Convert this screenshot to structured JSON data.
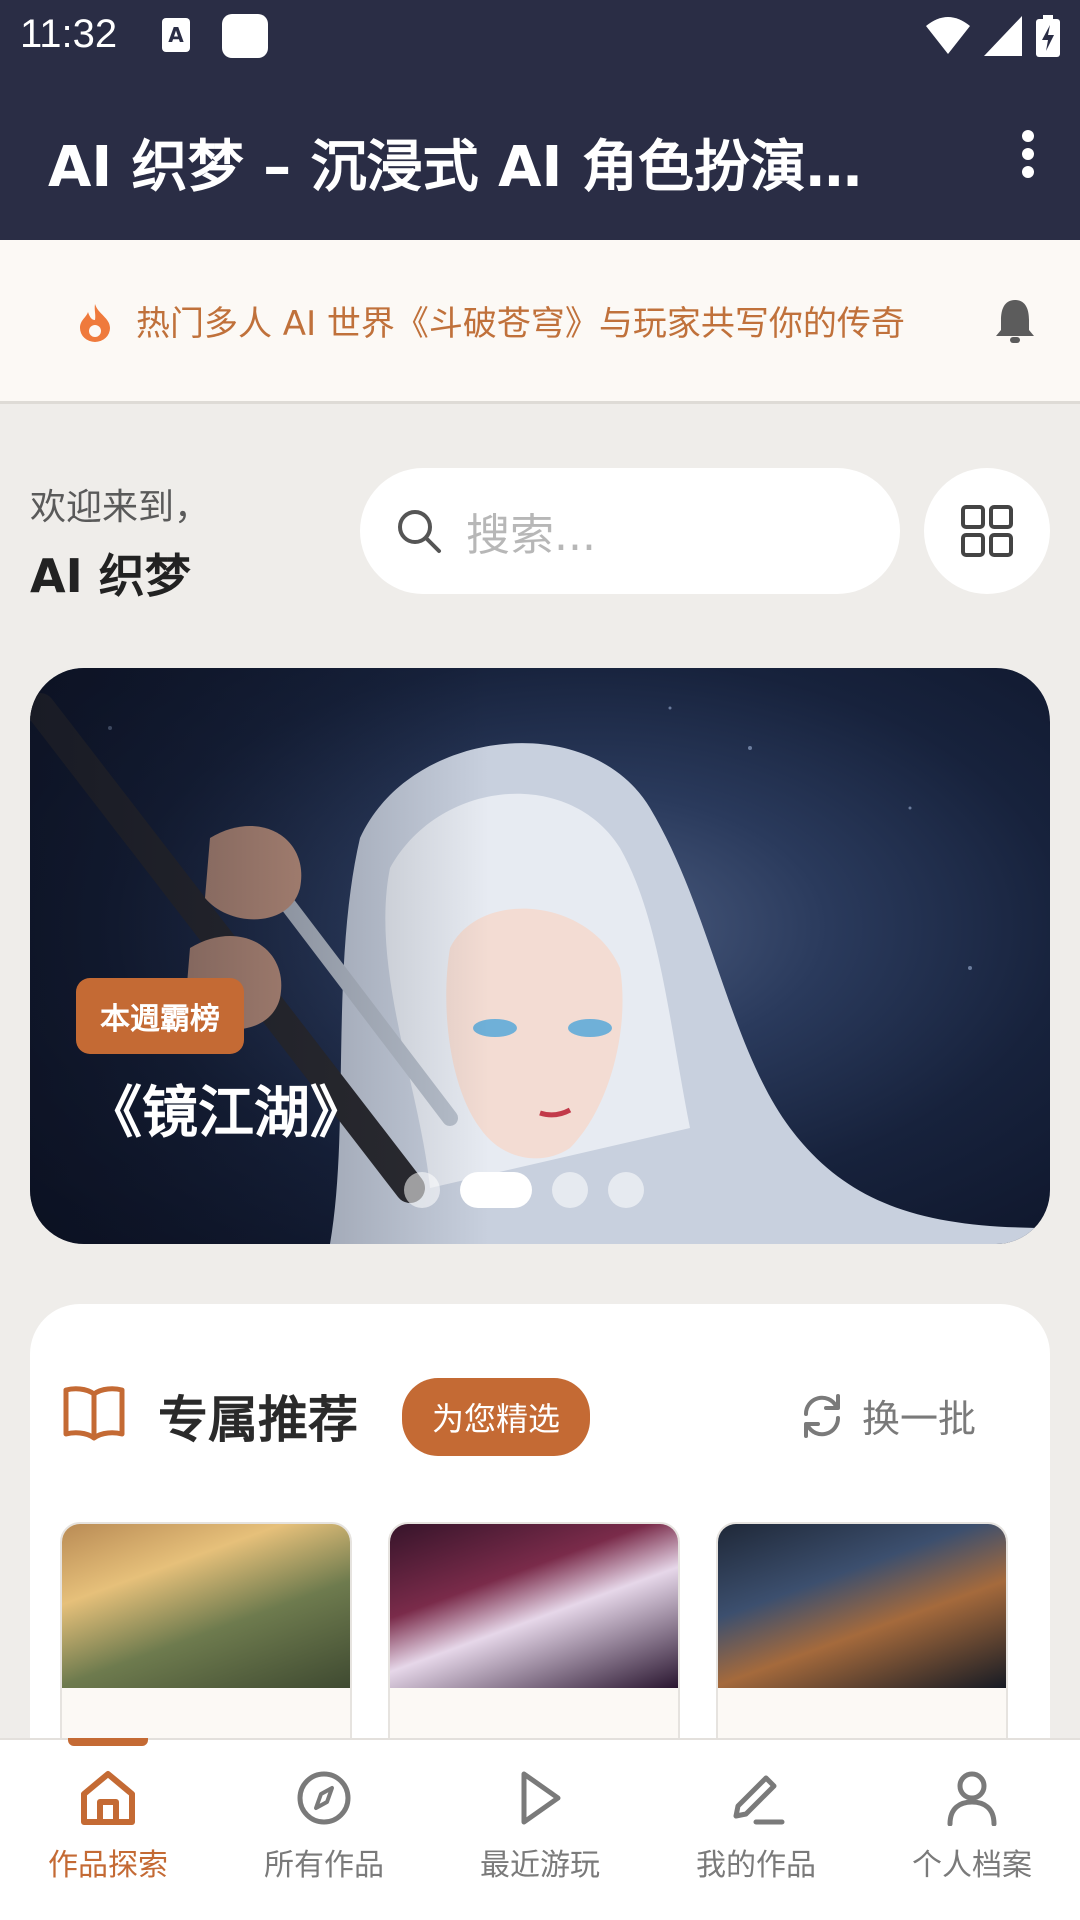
{
  "status_bar": {
    "time": "11:32",
    "keyboard_label": "A"
  },
  "app_bar": {
    "title": "AI 织梦 – 沉浸式 AI 角色扮演…"
  },
  "notice": {
    "text": "热门多人 AI 世界《斗破苍穹》与玩家共写你的传奇"
  },
  "welcome": {
    "line1": "欢迎来到，",
    "line2": "AI 织梦"
  },
  "search": {
    "placeholder": "搜索..."
  },
  "banner": {
    "badge": "本週霸榜",
    "title": "《镜江湖》",
    "slide_count": 4,
    "active_slide": 2
  },
  "recommend": {
    "title": "专属推荐",
    "tag": "为您精选",
    "refresh_label": "换一批"
  },
  "bottom_nav": [
    {
      "label": "作品探索",
      "icon": "home-icon",
      "active": true
    },
    {
      "label": "所有作品",
      "icon": "compass-icon",
      "active": false
    },
    {
      "label": "最近游玩",
      "icon": "play-icon",
      "active": false
    },
    {
      "label": "我的作品",
      "icon": "pencil-icon",
      "active": false
    },
    {
      "label": "个人档案",
      "icon": "person-icon",
      "active": false
    }
  ],
  "colors": {
    "accent": "#c46a34",
    "app_bar": "#2a2d45",
    "background": "#efedea"
  }
}
